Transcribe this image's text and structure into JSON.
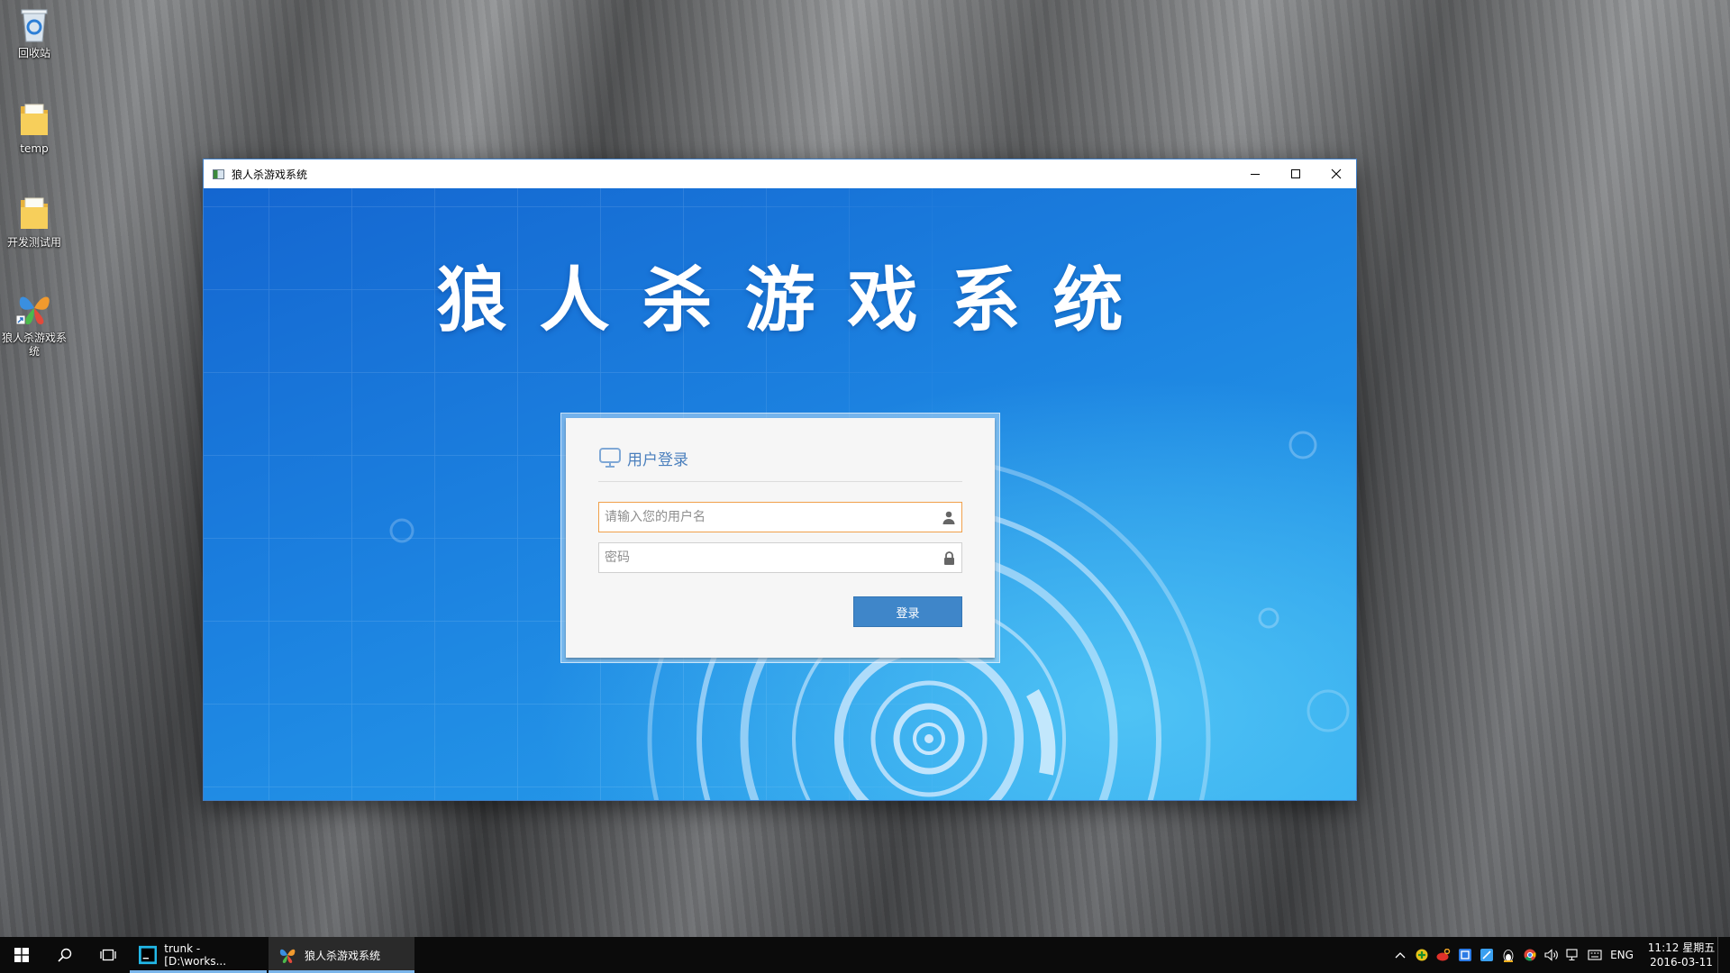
{
  "desktop": {
    "icons": [
      {
        "label": "回收站",
        "icon": "recycle-bin-icon"
      },
      {
        "label": "temp",
        "icon": "folder-icon"
      },
      {
        "label": "开发测试用",
        "icon": "folder-icon"
      },
      {
        "label": "狼人杀游戏系统",
        "icon": "butterfly-app-icon"
      }
    ]
  },
  "window": {
    "title": "狼人杀游戏系统",
    "headline": "狼人杀游戏系统"
  },
  "login": {
    "header": "用户登录",
    "username_placeholder": "请输入您的用户名",
    "password_placeholder": "密码",
    "button_label": "登录"
  },
  "taskbar": {
    "tasks": [
      {
        "label": "trunk - [D:\\works...",
        "icon": "webstorm-icon",
        "active": false
      },
      {
        "label": "狼人杀游戏系统",
        "icon": "butterfly-app-icon",
        "active": true
      }
    ],
    "language": "ENG",
    "time": "11:12 星期五",
    "date": "2016-03-11"
  },
  "colors": {
    "accent": "#3f86c9",
    "focus_border": "#f0a04a",
    "header_text": "#4a7fbd"
  }
}
